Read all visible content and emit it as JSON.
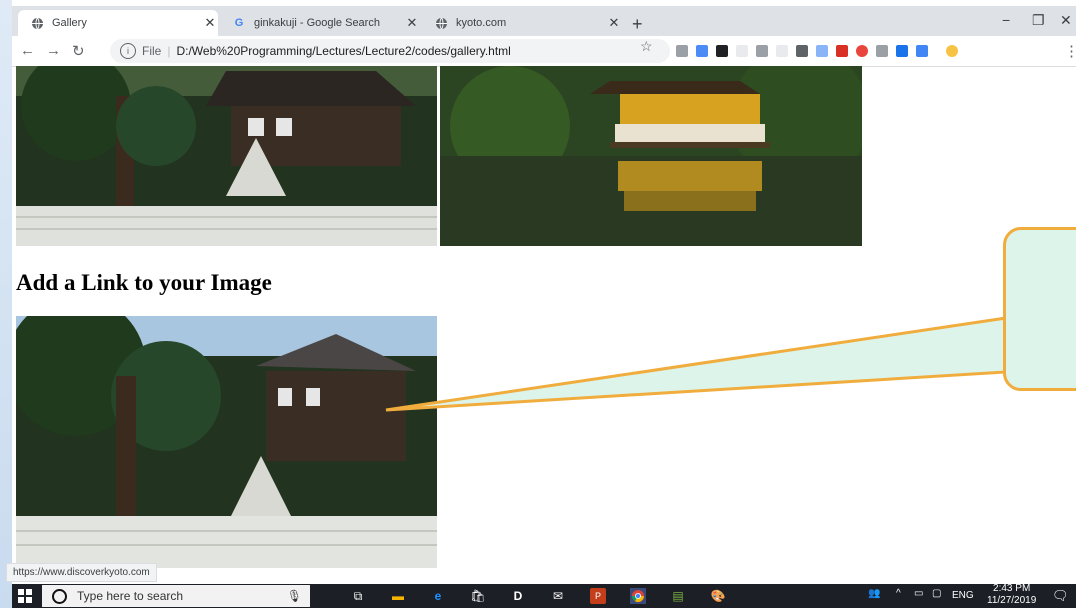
{
  "browser": {
    "tabs": [
      {
        "title": "Gallery",
        "icon": "globe-icon",
        "active": true
      },
      {
        "title": "ginkakuji - Google Search",
        "icon": "google-icon",
        "active": false
      },
      {
        "title": "kyoto.com",
        "icon": "globe-icon",
        "active": false
      }
    ],
    "new_tab_label": "+",
    "address_prefix": "File",
    "address_url": "D:/Web%20Programming/Lectures/Lecture2/codes/gallery.html",
    "window_controls": [
      "−",
      "❐",
      "✕"
    ]
  },
  "page": {
    "heading": "Add a Link to your Image",
    "images": [
      {
        "name": "ginkakuji-image",
        "alt": "Ginkakuji temple with sand garden"
      },
      {
        "name": "kinkakuji-image",
        "alt": "Kinkakuji golden pavilion reflected in pond"
      },
      {
        "name": "linked-ginkakuji-image",
        "alt": "Ginkakuji temple with sand garden"
      }
    ],
    "status_url": "https://www.discoverkyoto.com"
  },
  "annotation": {
    "callout_fill": "#ddf4ea",
    "callout_stroke": "#f0ad3d"
  },
  "taskbar": {
    "search_placeholder": "Type here to search",
    "tray_language": "ENG",
    "time": "2:43 PM",
    "date": "11/27/2019"
  },
  "colors": {
    "tabstrip": "#dee1e6",
    "taskbar": "#1d1f27",
    "accent_orange": "#f0ad3d"
  }
}
